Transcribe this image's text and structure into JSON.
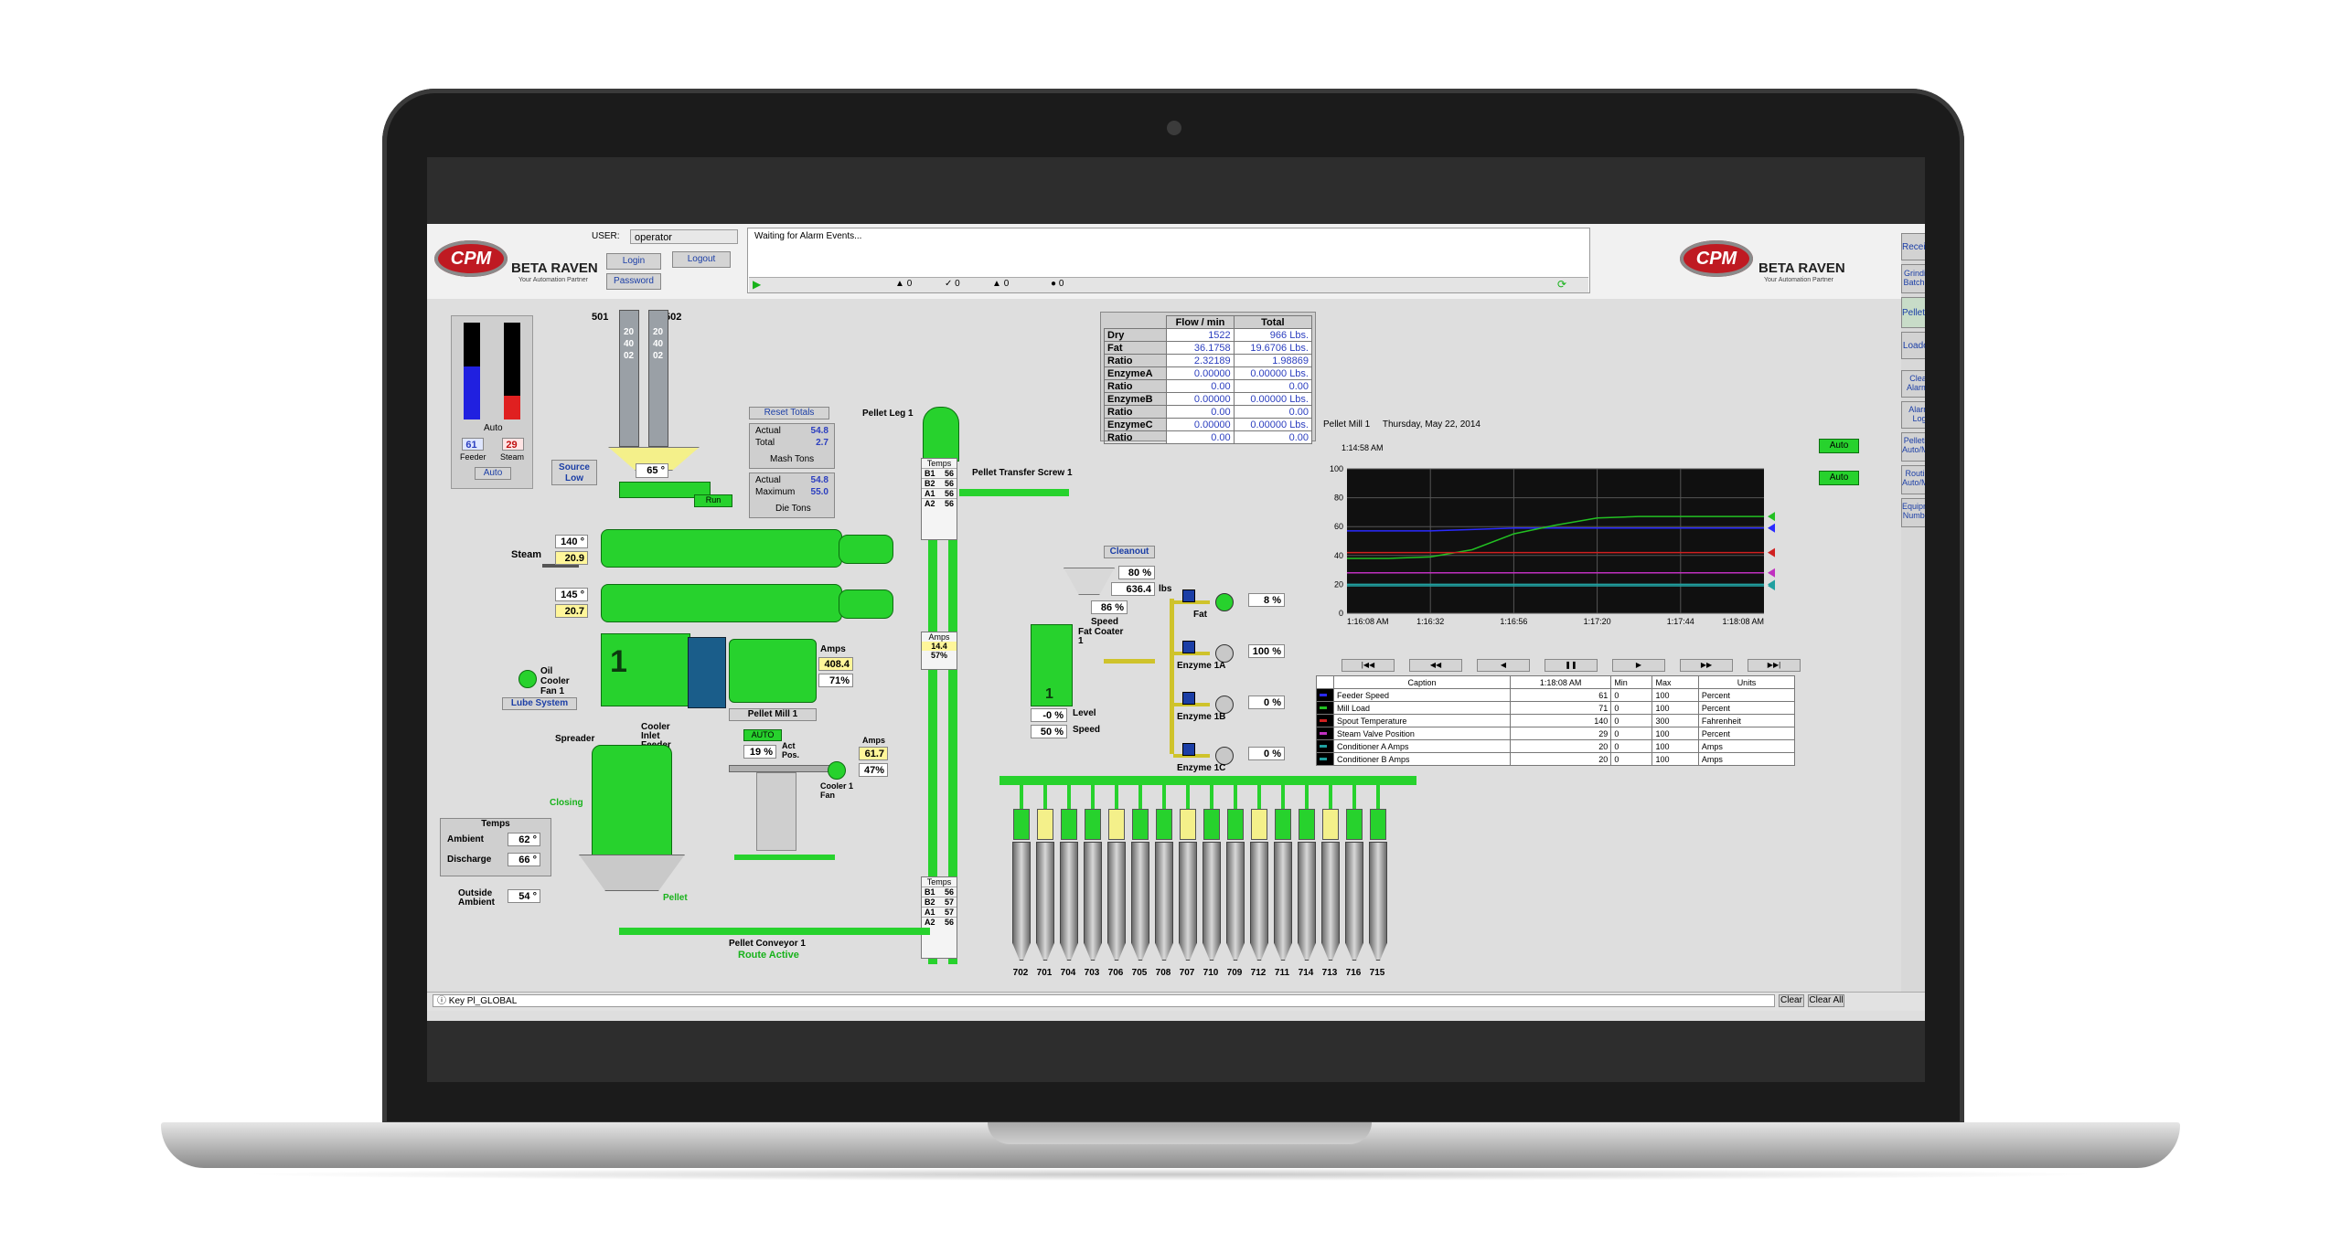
{
  "header": {
    "logo_text": "CPM",
    "brand": "BETA RAVEN",
    "tagline": "Your Automation Partner",
    "user_label": "USER:",
    "user_value": "operator",
    "login": "Login",
    "logout": "Logout",
    "password": "Password",
    "alarm_message": "Waiting for Alarm Events...",
    "alarm_counts": [
      "0",
      "0",
      "0",
      "0"
    ]
  },
  "side_nav": [
    "Receiving",
    "Grinding Batching",
    "Pelleting",
    "Loadout",
    "Clear Alarms",
    "Alarm Log",
    "Pelleting Auto/Man",
    "Routing Auto/Man",
    "Equipment Numbers"
  ],
  "gauges": {
    "mode": "Auto",
    "feeder_value": "61",
    "steam_value": "29",
    "feeder_label": "Feeder",
    "steam_label": "Steam",
    "auto": "Auto",
    "feeder_fill": 0.55,
    "steam_fill": 0.25
  },
  "bins_top": {
    "left_num": "501",
    "right_num": "502",
    "left_code": "204002",
    "right_code": "204002"
  },
  "source_low": "Source Low",
  "hopper_temp": "65",
  "run": "Run",
  "steam_label": "Steam",
  "cond1": {
    "temp": "140",
    "value": "20.9"
  },
  "cond2": {
    "temp": "145",
    "value": "20.7"
  },
  "oil_cooler": "Oil Cooler Fan 1",
  "lube": "Lube System",
  "mill_label": "Pellet Mill 1",
  "mill_amps": {
    "label": "Amps",
    "value": "408.4",
    "pct": "71"
  },
  "totals": {
    "reset": "Reset Totals",
    "actual_label": "Actual",
    "actual": "54.8",
    "total_label": "Total",
    "total": "2.7",
    "mash": "Mash Tons",
    "actual2_label": "Actual",
    "actual2": "54.8",
    "max_label": "Maximum",
    "max": "55.0",
    "die": "Die Tons"
  },
  "pellet_leg": "Pellet Leg 1",
  "leg_temps": {
    "label": "Temps",
    "rows": [
      [
        "B1",
        "56"
      ],
      [
        "B2",
        "56"
      ],
      [
        "A1",
        "56"
      ],
      [
        "A2",
        "56"
      ]
    ]
  },
  "leg_amps": {
    "label": "Amps",
    "value": "14.4",
    "pct": "57"
  },
  "leg_temps2": {
    "label": "Temps",
    "rows": [
      [
        "B1",
        "56"
      ],
      [
        "B2",
        "57"
      ],
      [
        "A1",
        "57"
      ],
      [
        "A2",
        "56"
      ]
    ]
  },
  "cooler": {
    "spreader": "Spreader",
    "inlet": "Cooler Inlet Feeder",
    "auto": "AUTO",
    "pct": "19",
    "act_pos": "Act Pos.",
    "fan": "Cooler 1 Fan",
    "amps_label": "Amps",
    "amps": "61.7",
    "amps_pct": "47",
    "closing": "Closing",
    "pellet": "Pellet"
  },
  "temps_box": {
    "title": "Temps",
    "ambient_label": "Ambient",
    "ambient": "62",
    "discharge_label": "Discharge",
    "discharge": "66",
    "outside_label": "Outside Ambient",
    "outside": "54"
  },
  "conveyor": {
    "name": "Pellet Conveyor 1",
    "status": "Route Active"
  },
  "transfer": "Pellet Transfer Screw 1",
  "cleanout": "Cleanout",
  "coater": {
    "pct": "80",
    "lbs": "636.4",
    "lbs_unit": "lbs",
    "speed_pct": "86",
    "speed": "Speed",
    "name": "Fat Coater 1",
    "level_val": "-0",
    "level": "Level",
    "speed2_val": "50",
    "speed2": "Speed"
  },
  "flow_table": {
    "headers": [
      "Flow / min",
      "Total"
    ],
    "rows": [
      [
        "Dry",
        "1522",
        "966 Lbs."
      ],
      [
        "Fat",
        "36.1758",
        "19.6706 Lbs."
      ],
      [
        "Ratio",
        "2.32189",
        "1.98869"
      ],
      [
        "EnzymeA",
        "0.00000",
        "0.00000 Lbs."
      ],
      [
        "Ratio",
        "0.00",
        "0.00"
      ],
      [
        "EnzymeB",
        "0.00000",
        "0.00000 Lbs."
      ],
      [
        "Ratio",
        "0.00",
        "0.00"
      ],
      [
        "EnzymeC",
        "0.00000",
        "0.00000 Lbs."
      ],
      [
        "Ratio",
        "0.00",
        "0.00"
      ]
    ]
  },
  "pumps": [
    {
      "name": "Fat",
      "value": "8"
    },
    {
      "name": "Enzyme 1A",
      "value": "100"
    },
    {
      "name": "Enzyme 1B",
      "value": "0"
    },
    {
      "name": "Enzyme 1C",
      "value": "0"
    }
  ],
  "pct_sign": "%",
  "auto_buttons": [
    "Auto",
    "Auto"
  ],
  "chart_data": {
    "type": "line",
    "title": "Pellet Mill 1",
    "date": "Thursday, May 22, 2014",
    "start_label": "1:14:58 AM",
    "ylim": [
      0,
      100
    ],
    "yticks": [
      "100",
      "80",
      "60",
      "40",
      "20",
      "0"
    ],
    "x_ticks": [
      "1:16:08 AM",
      "1:16:32",
      "1:16:56",
      "1:17:20",
      "1:17:44",
      "1:18:08 AM"
    ],
    "series": [
      {
        "name": "Feeder Speed",
        "color": "#2a2aff",
        "values": [
          57,
          57,
          57,
          58,
          59,
          59,
          59,
          59,
          59,
          59,
          59
        ]
      },
      {
        "name": "Mill Load",
        "color": "#22c022",
        "values": [
          38,
          38,
          39,
          44,
          55,
          61,
          66,
          67,
          67,
          67,
          67
        ]
      },
      {
        "name": "Spout Temperature",
        "color": "#d02020",
        "values": [
          42,
          42,
          42,
          42,
          42,
          42,
          42,
          42,
          42,
          42,
          42
        ]
      },
      {
        "name": "Steam Valve Position",
        "color": "#c030c0",
        "values": [
          28,
          28,
          28,
          28,
          28,
          28,
          28,
          28,
          28,
          28,
          28
        ]
      },
      {
        "name": "Conditioner A Amps",
        "color": "#20a0a0",
        "values": [
          20,
          20,
          20,
          20,
          20,
          20,
          20,
          20,
          20,
          20,
          20
        ]
      },
      {
        "name": "Conditioner B Amps",
        "color": "#20a0a0",
        "values": [
          19,
          19,
          19,
          19,
          19,
          19,
          19,
          19,
          19,
          19,
          19
        ]
      }
    ]
  },
  "legend_table": {
    "headers": [
      "Caption",
      "1:18:08 AM",
      "Min",
      "Max",
      "Units"
    ],
    "rows": [
      [
        "Feeder Speed",
        "61",
        "0",
        "100",
        "Percent"
      ],
      [
        "Mill Load",
        "71",
        "0",
        "100",
        "Percent"
      ],
      [
        "Spout Temperature",
        "140",
        "0",
        "300",
        "Fahrenheit"
      ],
      [
        "Steam Valve Position",
        "29",
        "0",
        "100",
        "Percent"
      ],
      [
        "Conditioner A Amps",
        "20",
        "0",
        "100",
        "Amps"
      ],
      [
        "Conditioner B Amps",
        "20",
        "0",
        "100",
        "Amps"
      ]
    ]
  },
  "bins_bottom": [
    "702",
    "701",
    "704",
    "703",
    "706",
    "705",
    "708",
    "707",
    "710",
    "709",
    "712",
    "711",
    "714",
    "713",
    "716",
    "715"
  ],
  "status_bar": {
    "text": "Key Pl_GLOBAL",
    "clear": "Clear",
    "clear_all": "Clear All"
  }
}
